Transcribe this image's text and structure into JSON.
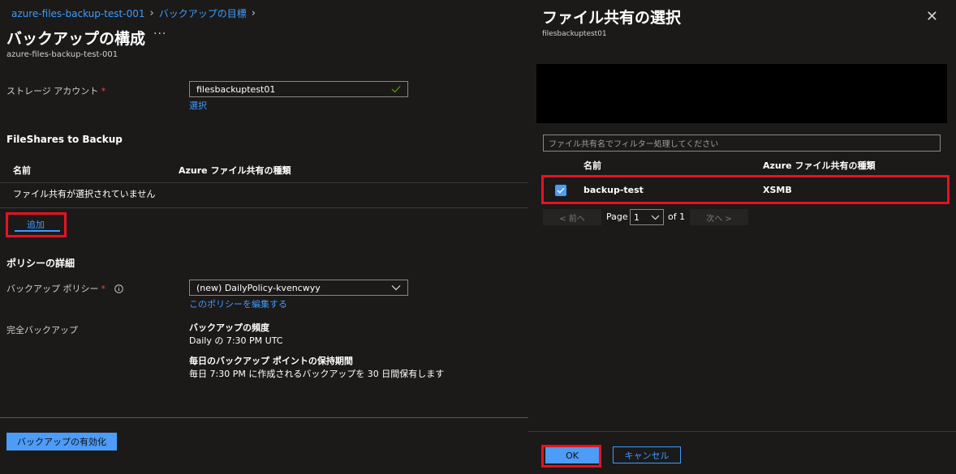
{
  "breadcrumb": [
    "azure-files-backup-test-001",
    "バックアップの目標"
  ],
  "page": {
    "title": "バックアップの構成",
    "more": "···",
    "subtitle": "azure-files-backup-test-001"
  },
  "storage": {
    "label": "ストレージ アカウント",
    "required_mark": "*",
    "value": "filesbackuptest01",
    "select_link": "選択"
  },
  "fileshares": {
    "heading": "FileShares to Backup",
    "columns": [
      "名前",
      "Azure ファイル共有の種類"
    ],
    "empty_text": "ファイル共有が選択されていません",
    "add_label": "追加"
  },
  "policy": {
    "heading": "ポリシーの詳細",
    "label": "バックアップ ポリシー",
    "required_mark": "*",
    "value": "(new) DailyPolicy-kvencwyy",
    "edit_link": "このポリシーを編集する",
    "full_backup_label": "完全バックアップ",
    "freq_title": "バックアップの頻度",
    "freq_value": "Daily の 7:30 PM UTC",
    "retention_title": "毎日のバックアップ ポイントの保持期間",
    "retention_value": "毎日 7:30 PM に作成されるバックアップを 30 日間保有します"
  },
  "enable_button": "バックアップの有効化",
  "panel": {
    "title": "ファイル共有の選択",
    "subtitle": "filesbackuptest01",
    "filter_placeholder": "ファイル共有名でフィルター処理してください",
    "columns": [
      "名前",
      "Azure ファイル共有の種類"
    ],
    "rows": [
      {
        "name": "backup-test",
        "type": "XSMB",
        "checked": true
      }
    ],
    "pager": {
      "prev": "< 前へ",
      "page_label": "Page",
      "page_value": "1",
      "of_label": "of 1",
      "next": "次へ >"
    },
    "ok": "OK",
    "cancel": "キャンセル"
  },
  "colors": {
    "accent": "#3f9bff",
    "primary_button": "#4c9cf8",
    "highlight": "#e81123"
  }
}
